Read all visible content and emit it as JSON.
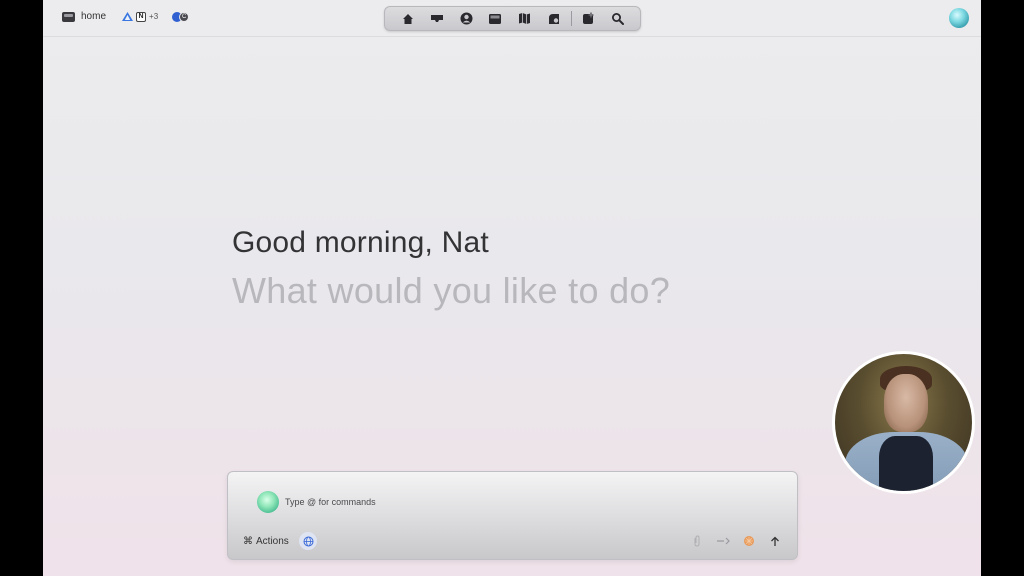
{
  "topbar": {
    "workspace_label": "home",
    "apps_extra_count": "+3",
    "app_n_letter": "N",
    "toggle_letter": "C"
  },
  "toolbar": {
    "icons": [
      "home-icon",
      "inbox-icon",
      "profile-icon",
      "archive-icon",
      "map-icon",
      "shape-icon",
      "new-window-icon",
      "search-icon"
    ]
  },
  "main": {
    "greeting": "Good morning, Nat",
    "prompt": "What would you like to do?"
  },
  "composer": {
    "placeholder": "Type @ for commands",
    "actions_label": "Actions",
    "actions_symbol": "⌘"
  },
  "colors": {
    "accent_orb": "#3aa0b0",
    "composer_orb": "#42b98f",
    "greeting_text": "#333336",
    "prompt_text": "#b8b8bc"
  }
}
